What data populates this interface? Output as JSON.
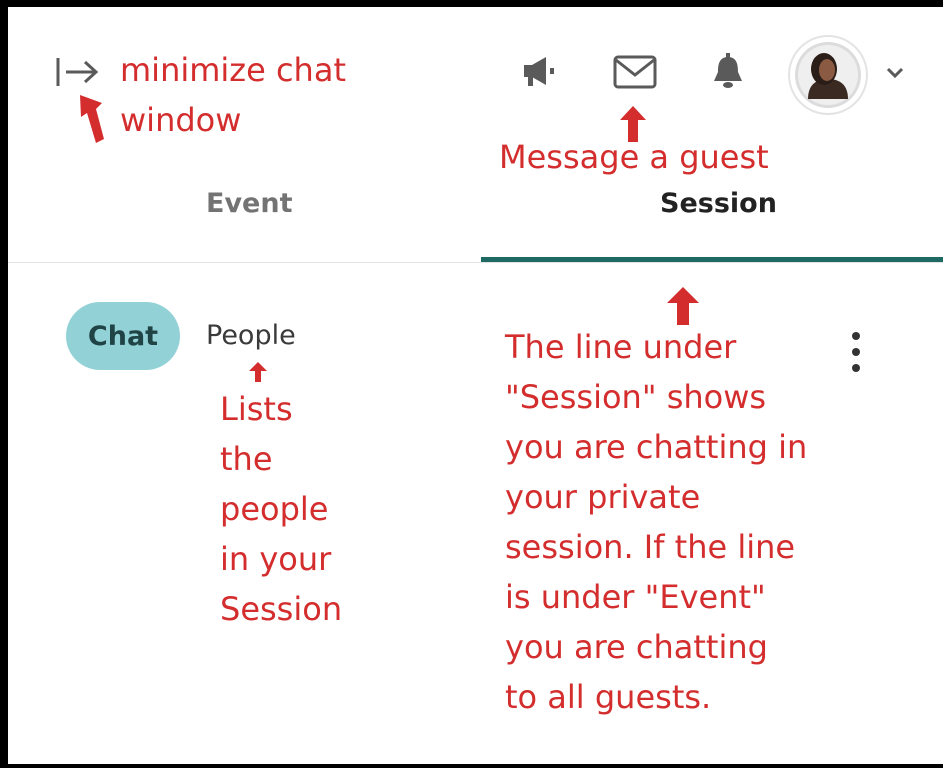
{
  "toolbar": {
    "minimize_icon": "minimize-chat-arrow-icon",
    "announce_icon": "megaphone-icon",
    "message_icon": "envelope-icon",
    "notifications_icon": "bell-icon",
    "profile_icon": "user-avatar",
    "menu_icon": "chevron-down-icon"
  },
  "tabs": [
    {
      "label": "Event",
      "selected": false
    },
    {
      "label": "Session",
      "selected": true
    }
  ],
  "subtabs": {
    "chat_label": "Chat",
    "people_label": "People"
  },
  "more_icon": "kebab-menu-icon",
  "annotations": {
    "minimize": "minimize chat\nwindow",
    "message": "Message a guest",
    "people": "Lists\nthe\npeople\nin your\nSession",
    "session_line": "The line under\n\"Session\" shows\nyou are chatting in\nyour private\nsession. If the line\nis under \"Event\"\nyou are chatting\nto all guests."
  },
  "colors": {
    "annotation": "#d42d2d",
    "accent_underline": "#1f6964",
    "chat_pill": "#92d1d6"
  }
}
